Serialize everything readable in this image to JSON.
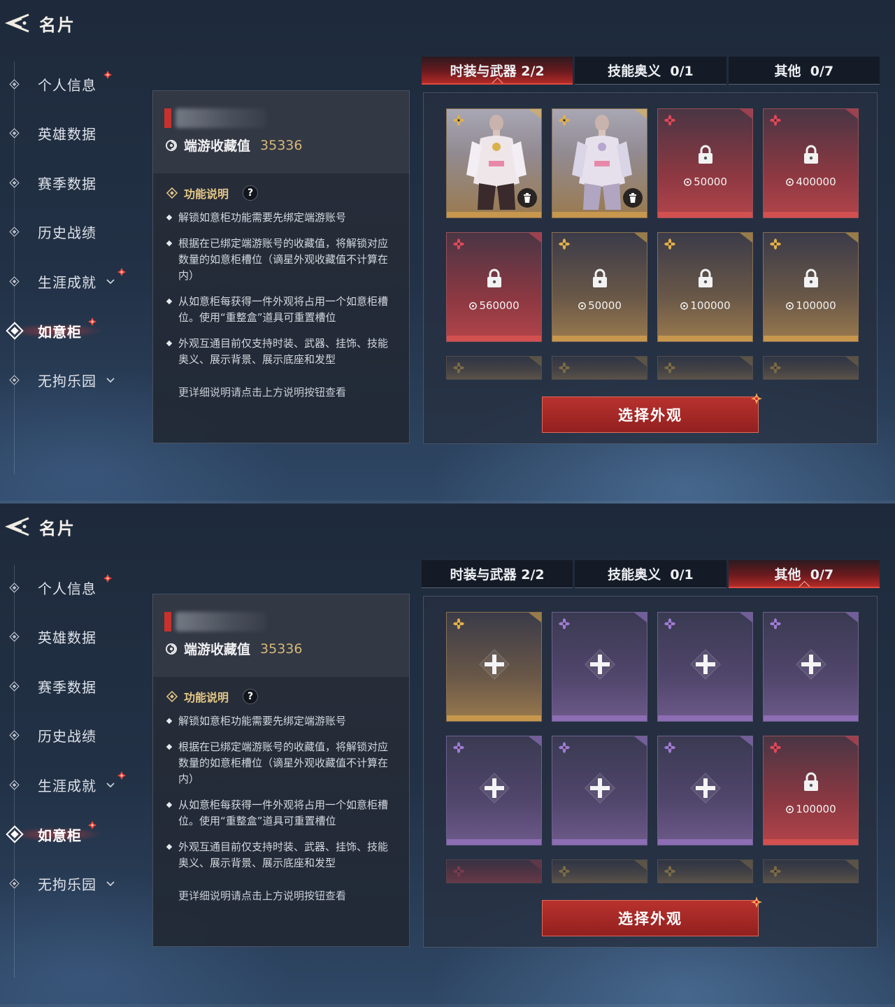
{
  "screens": [
    {
      "header": {
        "title": "名片"
      },
      "sidebar": {
        "items": [
          {
            "label": "个人信息"
          },
          {
            "label": "英雄数据"
          },
          {
            "label": "赛季数据"
          },
          {
            "label": "历史战绩"
          },
          {
            "label": "生涯成就"
          },
          {
            "label": "如意柜"
          },
          {
            "label": "无拘乐园"
          }
        ]
      },
      "info": {
        "collect_label": "端游收藏值",
        "collect_value": "35336",
        "func_title": "功能说明",
        "help_label": "?",
        "bullets": [
          "解锁如意柜功能需要先绑定端游账号",
          "根据在已绑定端游账号的收藏值，将解锁对应数量的如意柜槽位（谪星外观收藏值不计算在内）",
          "从如意柜每获得一件外观将占用一个如意柜槽位。使用“重整盒”道具可重置槽位",
          "外观互通目前仅支持时装、武器、挂饰、技能奥义、展示背景、展示底座和发型"
        ],
        "footer": "更详细说明请点击上方说明按钮查看"
      },
      "tabs": [
        {
          "label": "时装与武器 2/2",
          "active": true
        },
        {
          "label": "技能奥义  0/1",
          "active": false
        },
        {
          "label": "其他  0/7",
          "active": false
        }
      ],
      "slots": [
        {
          "type": "owned",
          "rarity": "gold",
          "price": ""
        },
        {
          "type": "owned",
          "rarity": "gold",
          "price": ""
        },
        {
          "type": "locked",
          "rarity": "red",
          "price": "50000"
        },
        {
          "type": "locked",
          "rarity": "red",
          "price": "400000"
        },
        {
          "type": "locked",
          "rarity": "red",
          "price": "560000"
        },
        {
          "type": "locked",
          "rarity": "gold",
          "price": "50000"
        },
        {
          "type": "locked",
          "rarity": "gold",
          "price": "100000"
        },
        {
          "type": "locked",
          "rarity": "gold",
          "price": "100000"
        }
      ],
      "select_button": "选择外观"
    },
    {
      "header": {
        "title": "名片"
      },
      "sidebar": {
        "items": [
          {
            "label": "个人信息"
          },
          {
            "label": "英雄数据"
          },
          {
            "label": "赛季数据"
          },
          {
            "label": "历史战绩"
          },
          {
            "label": "生涯成就"
          },
          {
            "label": "如意柜"
          },
          {
            "label": "无拘乐园"
          }
        ]
      },
      "info": {
        "collect_label": "端游收藏值",
        "collect_value": "35336",
        "func_title": "功能说明",
        "help_label": "?",
        "bullets": [
          "解锁如意柜功能需要先绑定端游账号",
          "根据在已绑定端游账号的收藏值，将解锁对应数量的如意柜槽位（谪星外观收藏值不计算在内）",
          "从如意柜每获得一件外观将占用一个如意柜槽位。使用“重整盒”道具可重置槽位",
          "外观互通目前仅支持时装、武器、挂饰、技能奥义、展示背景、展示底座和发型"
        ],
        "footer": "更详细说明请点击上方说明按钮查看"
      },
      "tabs": [
        {
          "label": "时装与武器 2/2",
          "active": false
        },
        {
          "label": "技能奥义  0/1",
          "active": false
        },
        {
          "label": "其他  0/7",
          "active": true
        }
      ],
      "slots": [
        {
          "type": "empty",
          "rarity": "gold",
          "price": ""
        },
        {
          "type": "empty",
          "rarity": "purple",
          "price": ""
        },
        {
          "type": "empty",
          "rarity": "purple",
          "price": ""
        },
        {
          "type": "empty",
          "rarity": "purple",
          "price": ""
        },
        {
          "type": "empty",
          "rarity": "purple",
          "price": ""
        },
        {
          "type": "empty",
          "rarity": "purple",
          "price": ""
        },
        {
          "type": "empty",
          "rarity": "purple",
          "price": ""
        },
        {
          "type": "locked",
          "rarity": "red",
          "price": "100000"
        }
      ],
      "select_button": "选择外观"
    }
  ],
  "colors": {
    "accent_red": "#c8312d",
    "gold_text": "#d8b878",
    "rarity_red": "#d2504f",
    "rarity_gold": "#c7974e",
    "rarity_purple": "#8d6db4"
  },
  "icons": {
    "back": "back-arrow-icon",
    "nav_bullet": "diamond-icon",
    "notify": "red-dot-icon",
    "expand": "chevron-down-icon",
    "collect": "swirl-coin-icon",
    "lock": "lock-icon",
    "plus": "plus-icon",
    "trash": "trash-icon",
    "rarity": "flower-star-icon"
  }
}
